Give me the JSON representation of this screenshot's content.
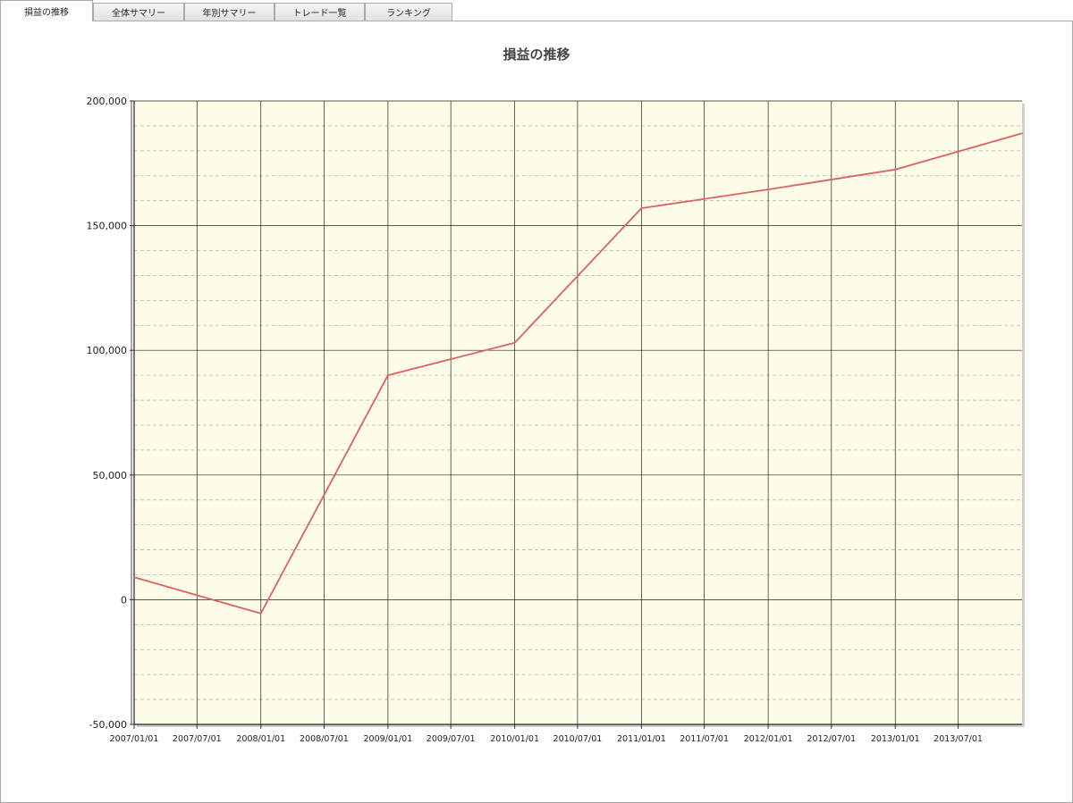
{
  "tabs": [
    {
      "label": "損益の推移",
      "active": true
    },
    {
      "label": "全体サマリー",
      "active": false
    },
    {
      "label": "年別サマリー",
      "active": false
    },
    {
      "label": "トレード一覧",
      "active": false
    },
    {
      "label": "ランキング",
      "active": false
    }
  ],
  "colors": {
    "plot_background": "#fdfde8",
    "series_line": "#e06060",
    "major_grid": "#222222",
    "minor_grid": "#b8b8a8"
  },
  "chart_data": {
    "type": "line",
    "title": "損益の推移",
    "xlabel": "",
    "ylabel": "",
    "x_tick_labels": [
      "2007/01/01",
      "2007/07/01",
      "2008/01/01",
      "2008/07/01",
      "2009/01/01",
      "2009/07/01",
      "2010/01/01",
      "2010/07/01",
      "2011/01/01",
      "2011/07/01",
      "2012/01/01",
      "2012/07/01",
      "2013/01/01",
      "2013/07/01"
    ],
    "x_range": [
      "2007/01/01",
      "2014/01/01"
    ],
    "y_tick_labels": [
      "200,000",
      "150,000",
      "100,000",
      "50,000",
      "0",
      "-50,000"
    ],
    "ylim": [
      -50000,
      200000
    ],
    "grid": true,
    "legend": "none",
    "series": [
      {
        "x": [
          "2007/01/01",
          "2008/01/01",
          "2009/01/01",
          "2010/01/01",
          "2011/01/01",
          "2012/01/01",
          "2013/01/01",
          "2014/01/01"
        ],
        "values": [
          9000,
          -5500,
          90000,
          103000,
          157000,
          164500,
          172500,
          187000
        ]
      }
    ]
  }
}
